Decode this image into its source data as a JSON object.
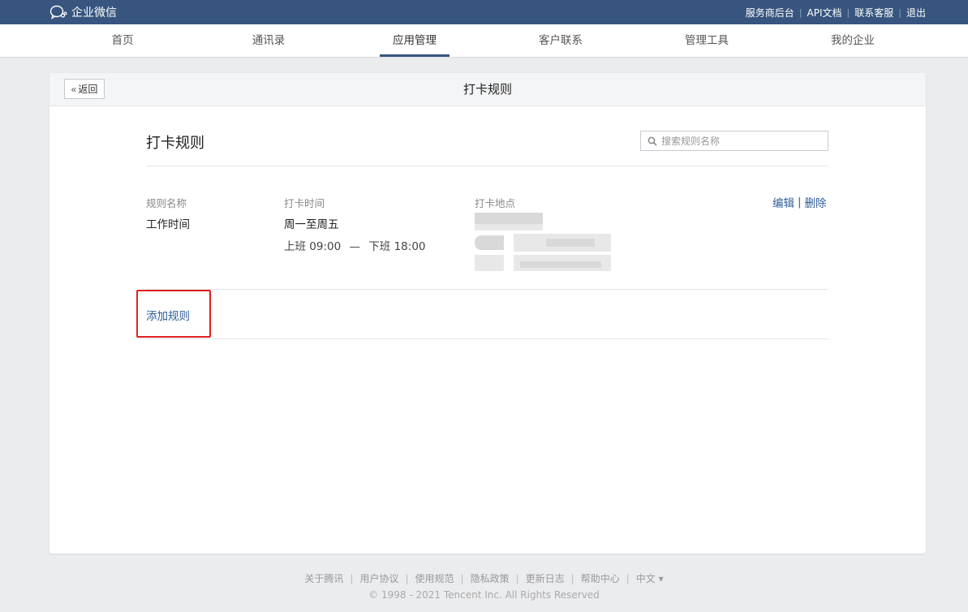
{
  "topbar": {
    "brand": "企业微信",
    "links": [
      "服务商后台",
      "API文档",
      "联系客服",
      "退出"
    ]
  },
  "nav": {
    "items": [
      "首页",
      "通讯录",
      "应用管理",
      "客户联系",
      "管理工具",
      "我的企业"
    ],
    "active": "应用管理"
  },
  "panel": {
    "back_label": "返回",
    "title": "打卡规则"
  },
  "content": {
    "title": "打卡规则",
    "search_placeholder": "搜索规则名称"
  },
  "rule": {
    "col_name": "规则名称",
    "col_time": "打卡时间",
    "col_place": "打卡地点",
    "name": "工作时间",
    "days": "周一至周五",
    "on_label": "上班",
    "on_time": "09:00",
    "dash": "—",
    "off_label": "下班",
    "off_time": "18:00",
    "edit": "编辑",
    "delete": "删除"
  },
  "add_rule": "添加规则",
  "footer": {
    "links": [
      "关于腾讯",
      "用户协议",
      "使用规范",
      "隐私政策",
      "更新日志",
      "帮助中心",
      "中文 ▾"
    ],
    "copyright": "© 1998 - 2021 Tencent Inc. All Rights Reserved"
  },
  "colors": {
    "topbar": "#37557f",
    "link": "#2f5d99",
    "highlight": "#e02020"
  }
}
